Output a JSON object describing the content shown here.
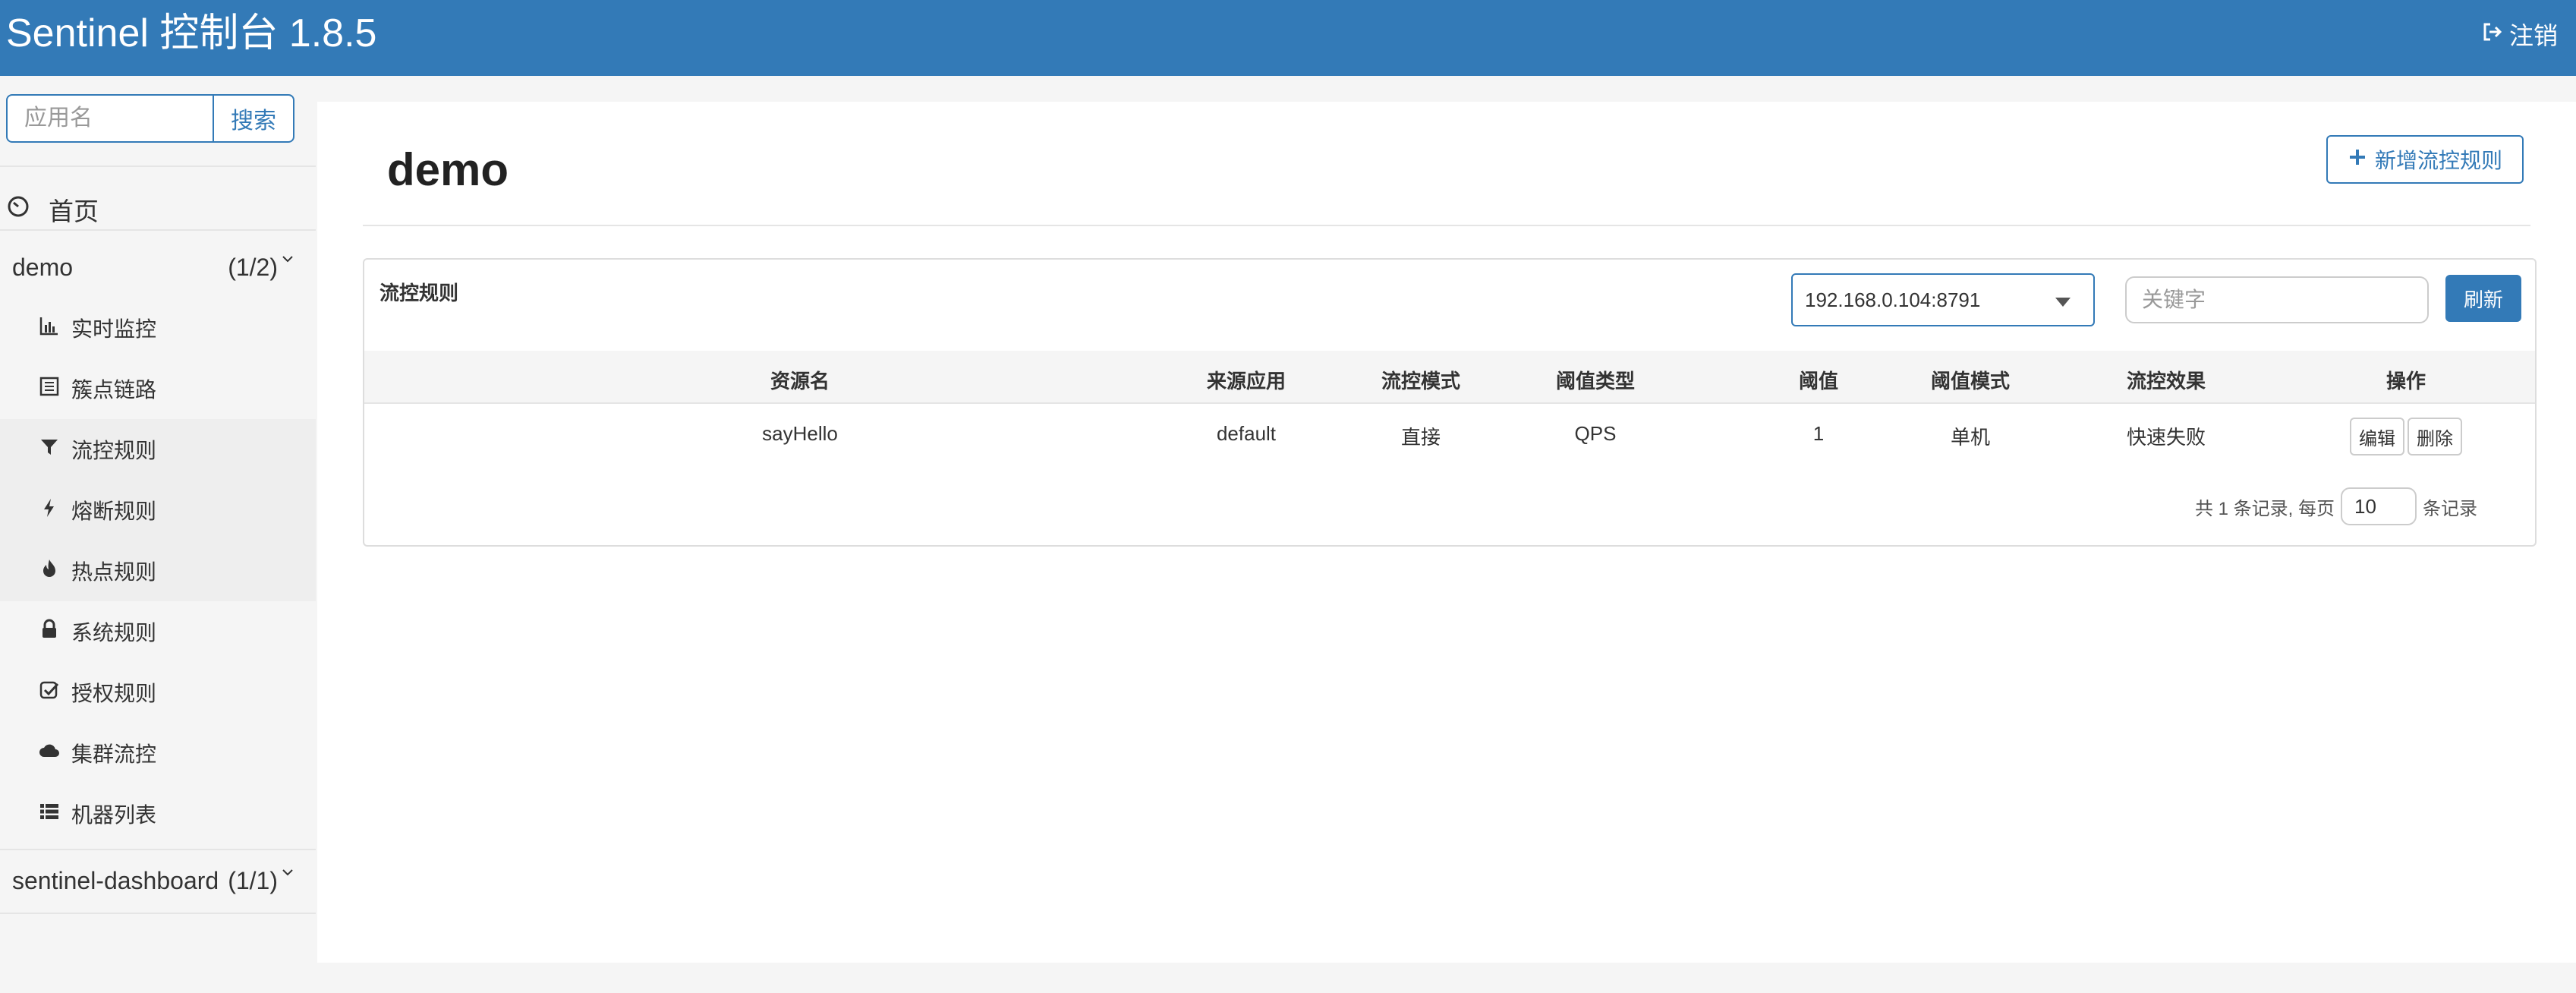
{
  "header": {
    "title": "Sentinel 控制台 1.8.5",
    "logout_label": "注销",
    "brand_color": "#337ab7"
  },
  "sidebar": {
    "search": {
      "placeholder": "应用名",
      "value": "",
      "button_label": "搜索"
    },
    "home_label": "首页",
    "apps": [
      {
        "name": "demo",
        "count": "(1/2)",
        "expanded": true
      },
      {
        "name": "sentinel-dashboard",
        "count": "(1/1)",
        "expanded": false
      }
    ],
    "menu": [
      {
        "label": "实时监控",
        "icon": "bar-chart-icon"
      },
      {
        "label": "簇点链路",
        "icon": "list-alt-icon"
      },
      {
        "label": "流控规则",
        "icon": "filter-icon"
      },
      {
        "label": "熔断规则",
        "icon": "flash-icon"
      },
      {
        "label": "热点规则",
        "icon": "fire-icon"
      },
      {
        "label": "系统规则",
        "icon": "lock-icon"
      },
      {
        "label": "授权规则",
        "icon": "check-icon"
      },
      {
        "label": "集群流控",
        "icon": "cloud-icon"
      },
      {
        "label": "机器列表",
        "icon": "th-list-icon"
      }
    ]
  },
  "main": {
    "title": "demo",
    "add_rule_label": "新增流控规则",
    "panel_title": "流控规则",
    "machine_select": "192.168.0.104:8791",
    "keyword_placeholder": "关键字",
    "refresh_label": "刷新",
    "table": {
      "columns": [
        "资源名",
        "来源应用",
        "流控模式",
        "阈值类型",
        "阈值",
        "阈值模式",
        "流控效果",
        "操作"
      ],
      "rows": [
        [
          "sayHello",
          "default",
          "直接",
          "QPS",
          "1",
          "单机",
          "快速失败"
        ]
      ],
      "edit_label": "编辑",
      "delete_label": "删除"
    },
    "pagination": {
      "prefix": "共 1 条记录, 每页",
      "page_size": "10",
      "suffix": "条记录"
    }
  }
}
